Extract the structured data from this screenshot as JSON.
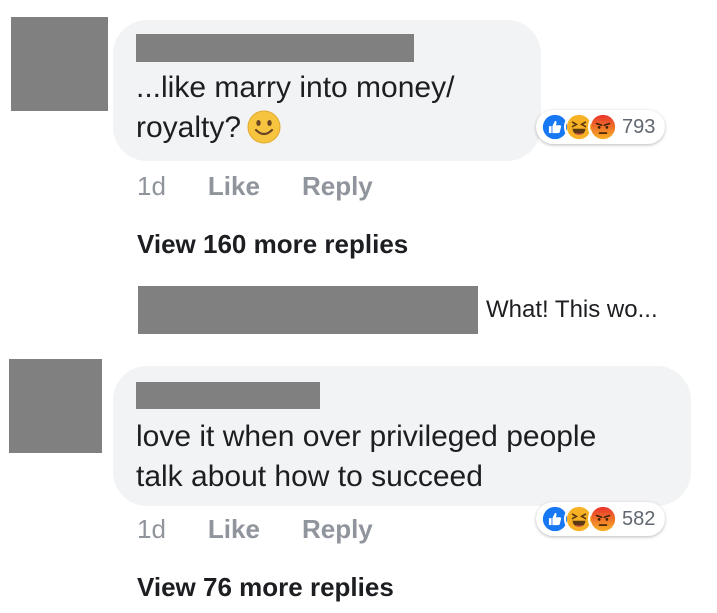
{
  "colors": {
    "bubble": "#f2f3f5",
    "redaction": "#808080",
    "muted_text": "#90949c",
    "like_blue": "#1877f2",
    "haha_yellow": "#f7b125",
    "angry_orange": "#e9710f"
  },
  "comments": [
    {
      "text_line1": "...like marry into money/",
      "text_line2": "royalty?",
      "inline_emoji": "slightly-smiling-face",
      "reactions": [
        "like",
        "haha",
        "angry"
      ],
      "reaction_count": "793",
      "timestamp": "1d",
      "like_label": "Like",
      "reply_label": "Reply",
      "view_more": "View 160 more replies",
      "reply_preview_text": "What! This wo..."
    },
    {
      "text_line1": "love it when over privileged people",
      "text_line2": "talk about how to succeed",
      "reactions": [
        "like",
        "haha",
        "angry"
      ],
      "reaction_count": "582",
      "timestamp": "1d",
      "like_label": "Like",
      "reply_label": "Reply",
      "view_more": "View 76 more replies"
    }
  ]
}
